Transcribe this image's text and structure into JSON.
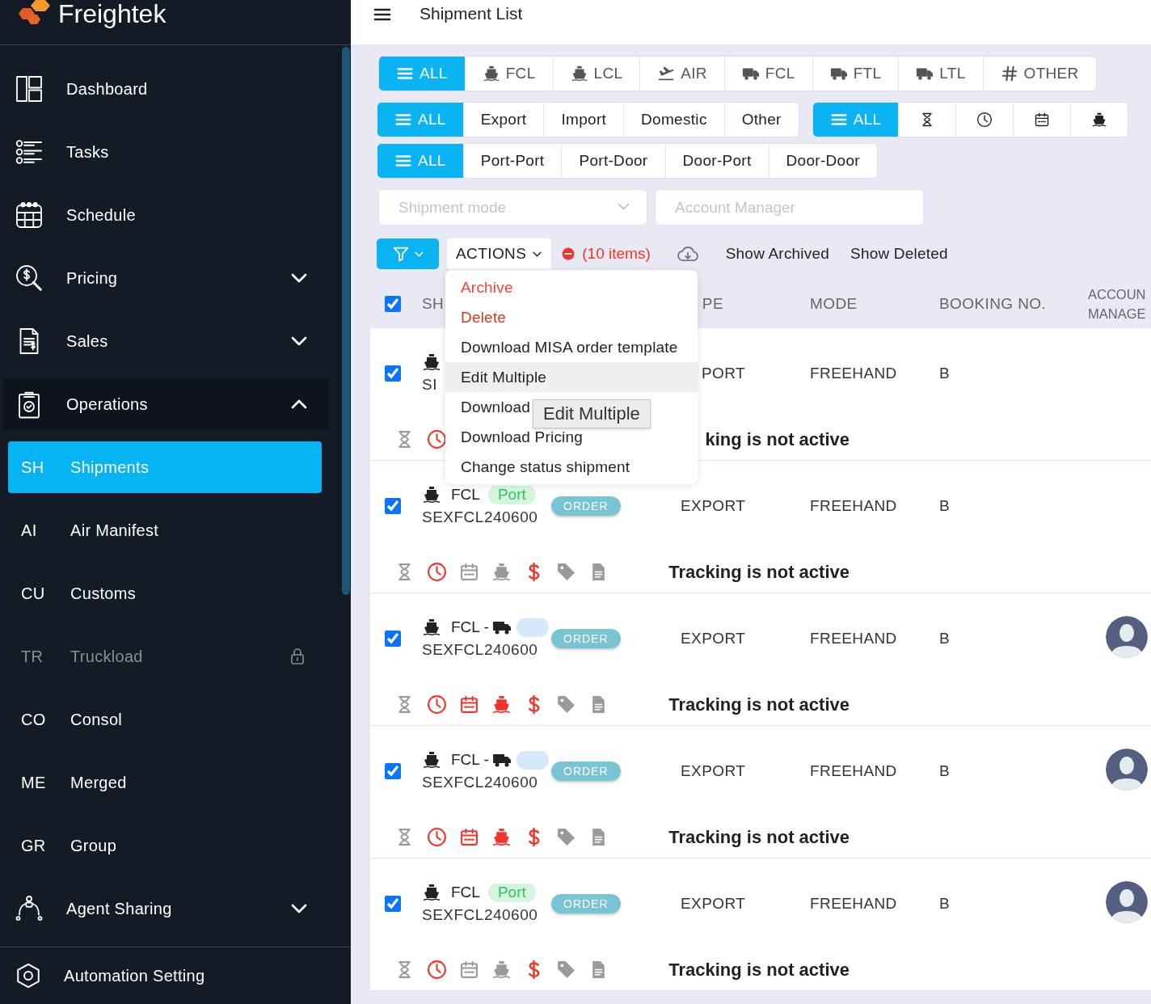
{
  "sidebar": {
    "brand": "Freightek",
    "items": [
      {
        "kind": "section",
        "label": "Dashboard",
        "selected": false,
        "disabled": false
      },
      {
        "kind": "section",
        "label": "Tasks",
        "selected": false,
        "disabled": false
      },
      {
        "kind": "section",
        "label": "Schedule",
        "selected": false,
        "disabled": false
      },
      {
        "kind": "section",
        "label": "Pricing",
        "selected": false,
        "disabled": false,
        "expanded": false
      },
      {
        "kind": "section",
        "label": "Sales",
        "selected": false,
        "disabled": false,
        "expanded": false
      },
      {
        "kind": "section",
        "label": "Operations",
        "selected": false,
        "disabled": false,
        "expanded": true
      },
      {
        "kind": "sub",
        "code": "SH",
        "label": "Shipments",
        "selected": true,
        "disabled": false
      },
      {
        "kind": "sub",
        "code": "AI",
        "label": "Air Manifest",
        "selected": false,
        "disabled": false
      },
      {
        "kind": "sub",
        "code": "CU",
        "label": "Customs",
        "selected": false,
        "disabled": false
      },
      {
        "kind": "sub",
        "code": "TR",
        "label": "Truckload",
        "selected": false,
        "disabled": true
      },
      {
        "kind": "sub",
        "code": "CO",
        "label": "Consol",
        "selected": false,
        "disabled": false
      },
      {
        "kind": "sub",
        "code": "ME",
        "label": "Merged",
        "selected": false,
        "disabled": false
      },
      {
        "kind": "sub",
        "code": "GR",
        "label": "Group",
        "selected": false,
        "disabled": false
      },
      {
        "kind": "section",
        "label": "Agent Sharing",
        "selected": false,
        "disabled": false,
        "expanded": false
      }
    ],
    "footer": {
      "label": "Automation Setting"
    }
  },
  "header": {
    "title": "Shipment List"
  },
  "filters": {
    "rows": [
      {
        "groups": [
          {
            "tabs": [
              {
                "label": "ALL",
                "selected": true
              },
              {
                "label": "FCL",
                "selected": false
              },
              {
                "label": "LCL",
                "selected": false
              },
              {
                "label": "AIR",
                "selected": false
              },
              {
                "label": "FCL",
                "selected": false
              },
              {
                "label": "FTL",
                "selected": false
              },
              {
                "label": "LTL",
                "selected": false
              },
              {
                "label": "OTHER",
                "selected": false
              }
            ]
          }
        ]
      },
      {
        "groups": [
          {
            "tabs": [
              {
                "label": "ALL",
                "selected": true
              },
              {
                "label": "Export",
                "selected": false
              },
              {
                "label": "Import",
                "selected": false
              },
              {
                "label": "Domestic",
                "selected": false
              },
              {
                "label": "Other",
                "selected": false
              }
            ]
          },
          {
            "tabs": [
              {
                "label": "ALL",
                "selected": true
              },
              {
                "selected": false
              },
              {
                "selected": false
              },
              {
                "selected": false
              },
              {
                "selected": false
              }
            ]
          }
        ]
      },
      {
        "groups": [
          {
            "tabs": [
              {
                "label": "ALL",
                "selected": true
              },
              {
                "label": "Port-Port",
                "selected": false
              },
              {
                "label": "Port-Door",
                "selected": false
              },
              {
                "label": "Door-Port",
                "selected": false
              },
              {
                "label": "Door-Door",
                "selected": false
              }
            ]
          }
        ]
      }
    ]
  },
  "selects": [
    {
      "placeholder": "Shipment mode",
      "dropdown": true
    },
    {
      "placeholder": "Account Manager",
      "dropdown": false
    }
  ],
  "toolbar": {
    "actions": {
      "label": "ACTIONS",
      "open": true,
      "menu": [
        {
          "label": "Archive",
          "kind": "danger",
          "highlighted": false
        },
        {
          "label": "Delete",
          "kind": "destructive",
          "highlighted": false
        },
        {
          "label": "Download MISA order template",
          "kind": "normal",
          "highlighted": false
        },
        {
          "label": "Edit Multiple",
          "kind": "normal",
          "highlighted": true
        },
        {
          "label": "Download",
          "kind": "normal",
          "highlighted": false
        },
        {
          "label": "Download Pricing",
          "kind": "normal",
          "highlighted": false
        },
        {
          "label": "Change status shipment",
          "kind": "normal",
          "highlighted": false
        }
      ],
      "tooltip": "Edit Multiple"
    },
    "selection": "(10 items)",
    "show_archived": "Show Archived",
    "show_deleted": "Show Deleted"
  },
  "table": {
    "all_checked": true,
    "columns": [
      "SH",
      "PE",
      "MODE",
      "BOOKING NO.",
      "ACCOUN\nMANAGE"
    ],
    "rows": [
      {
        "kind": "sea",
        "checked": true,
        "code": "SI",
        "type": "PORT",
        "mode": "FREEHAND",
        "booking": "B",
        "avatar": false,
        "indicators": [
          {
            "active": false
          },
          {
            "active": true
          }
        ],
        "tracking": "king is not active"
      },
      {
        "kind": "sea",
        "checked": true,
        "service": "FCL",
        "tag": {
          "kind": "port",
          "label": "Port"
        },
        "code": "SEXFCL240600",
        "badge": "ORDER",
        "type": "EXPORT",
        "mode": "FREEHAND",
        "booking": "B",
        "avatar": false,
        "indicators": [
          {
            "active": false
          },
          {
            "active": true
          },
          {
            "active": false
          },
          {
            "active": false
          },
          {
            "active": true
          },
          {
            "active": false
          },
          {
            "active": false
          }
        ],
        "tracking": "Tracking is not active"
      },
      {
        "kind": "multimodal",
        "checked": true,
        "service": "FCL -",
        "tag": {
          "kind": "blank"
        },
        "code": "SEXFCL240600",
        "badge": "ORDER",
        "type": "EXPORT",
        "mode": "FREEHAND",
        "booking": "B",
        "avatar": true,
        "indicators": [
          {
            "active": false
          },
          {
            "active": true
          },
          {
            "active": true
          },
          {
            "active": true
          },
          {
            "active": true
          },
          {
            "active": false
          },
          {
            "active": false
          }
        ],
        "tracking": "Tracking is not active"
      },
      {
        "kind": "multimodal",
        "checked": true,
        "service": "FCL -",
        "tag": {
          "kind": "blank"
        },
        "code": "SEXFCL240600",
        "badge": "ORDER",
        "type": "EXPORT",
        "mode": "FREEHAND",
        "booking": "B",
        "avatar": true,
        "indicators": [
          {
            "active": false
          },
          {
            "active": true
          },
          {
            "active": true
          },
          {
            "active": true
          },
          {
            "active": true
          },
          {
            "active": false
          },
          {
            "active": false
          }
        ],
        "tracking": "Tracking is not active"
      },
      {
        "kind": "sea",
        "checked": true,
        "service": "FCL",
        "tag": {
          "kind": "port",
          "label": "Port"
        },
        "code": "SEXFCL240600",
        "badge": "ORDER",
        "type": "EXPORT",
        "mode": "FREEHAND",
        "booking": "B",
        "avatar": true,
        "indicators": [
          {
            "active": false
          },
          {
            "active": true
          },
          {
            "active": false
          },
          {
            "active": false
          },
          {
            "active": true
          },
          {
            "active": false
          },
          {
            "active": false
          }
        ],
        "tracking": "Tracking is not active"
      }
    ]
  }
}
